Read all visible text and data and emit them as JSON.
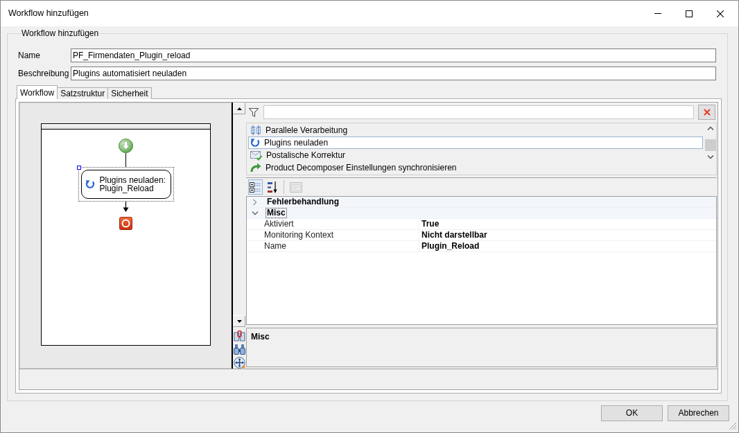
{
  "window": {
    "title": "Workflow hinzufügen"
  },
  "group": {
    "title": "Workflow hinzufügen"
  },
  "fields": [
    {
      "label": "Name",
      "value": "PF_Firmendaten_Plugin_reload"
    },
    {
      "label": "Beschreibung",
      "value": "Plugins automatisiert neuladen"
    }
  ],
  "tabs": [
    {
      "label": "Workflow",
      "selected": true
    },
    {
      "label": "Satzstruktur",
      "selected": false
    },
    {
      "label": "Sicherheit",
      "selected": false
    }
  ],
  "designer": {
    "nodes": [
      {
        "kind": "start",
        "selected": false
      },
      {
        "kind": "activity",
        "lines": [
          "Plugins neuladen:",
          "Plugin_Reload"
        ],
        "selected": true
      },
      {
        "kind": "end",
        "selected": false
      }
    ]
  },
  "activity_list": {
    "items": [
      {
        "kind": "parallel",
        "label": "Parallele Verarbeitung",
        "selected": false
      },
      {
        "kind": "reload",
        "label": "Plugins neuladen",
        "selected": true
      },
      {
        "kind": "postal",
        "label": "Postalische Korrektur",
        "selected": false
      },
      {
        "kind": "sync",
        "label": "Product Decomposer Einstellungen synchronisieren",
        "selected": false
      }
    ]
  },
  "toolbar": [
    {
      "kind": "categorized",
      "selected": true,
      "disabled": false
    },
    {
      "kind": "alphabetical",
      "selected": false,
      "disabled": false
    },
    {
      "kind": "pages",
      "selected": false,
      "disabled": true
    }
  ],
  "properties": {
    "categories": [
      {
        "name": "Fehlerbehandlung",
        "expanded": false,
        "selected": false
      },
      {
        "name": "Misc",
        "expanded": true,
        "selected": true,
        "rows": [
          {
            "name": "Aktiviert",
            "value": "True"
          },
          {
            "name": "Monitoring Kontext",
            "value": "Nicht darstellbar"
          },
          {
            "name": "Name",
            "value": "Plugin_Reload"
          }
        ]
      }
    ]
  },
  "description": {
    "title": "Misc"
  },
  "buttons": [
    {
      "label": "OK"
    },
    {
      "label": "Abbrechen"
    }
  ]
}
